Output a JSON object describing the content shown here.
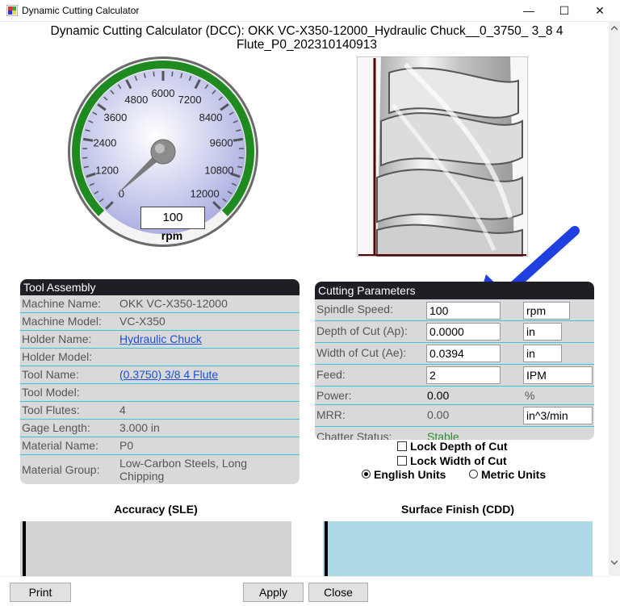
{
  "window": {
    "title": "Dynamic Cutting Calculator",
    "minimize": "—",
    "maximize": "☐",
    "close": "✕"
  },
  "header": {
    "title_line1": "Dynamic Cutting Calculator (DCC): OKK VC-X350-12000_Hydraulic Chuck__0_3750_ 3_8 4",
    "title_line2": "Flute_P0_202310140913"
  },
  "gauge": {
    "ticks": [
      "0",
      "1200",
      "2400",
      "3600",
      "4800",
      "6000",
      "7200",
      "8400",
      "9600",
      "10800",
      "12000"
    ],
    "value": "100",
    "value_number": 100,
    "max": 12000,
    "unit": "rpm"
  },
  "tool_assembly": {
    "header": "Tool Assembly",
    "rows": [
      {
        "label": "Machine Name:",
        "value": "OKK VC-X350-12000"
      },
      {
        "label": "Machine Model:",
        "value": "VC-X350"
      },
      {
        "label": "Holder Name:",
        "value": "Hydraulic Chuck"
      },
      {
        "label": "Holder Model:",
        "value": ""
      },
      {
        "label": "Tool Name:",
        "value": "(0.3750) 3/8 4 Flute"
      },
      {
        "label": "Tool Model:",
        "value": ""
      },
      {
        "label": "Tool Flutes:",
        "value": "4"
      },
      {
        "label": "Gage Length:",
        "value": "3.000 in"
      },
      {
        "label": "Material Name:",
        "value": "P0"
      },
      {
        "label": "Material Group:",
        "value": "Low-Carbon Steels, Long Chipping"
      }
    ]
  },
  "cutting_parameters": {
    "header": "Cutting Parameters",
    "spindle_speed": {
      "label": "Spindle Speed:",
      "value": "100",
      "unit": "rpm"
    },
    "depth_of_cut": {
      "label": "Depth of Cut (Ap):",
      "value": "0.0000",
      "unit": "in"
    },
    "width_of_cut": {
      "label": "Width of Cut (Ae):",
      "value": "0.0394",
      "unit": "in"
    },
    "feed": {
      "label": "Feed:",
      "value": "2",
      "unit": "IPM"
    },
    "power": {
      "label": "Power:",
      "value": "0.00",
      "unit": "%"
    },
    "mrr": {
      "label": "MRR:",
      "value": "0.00",
      "unit": "in^3/min"
    },
    "chatter": {
      "label": "Chatter Status:",
      "value": "Stable"
    }
  },
  "options": {
    "lock_depth": "Lock Depth of Cut",
    "lock_width": "Lock Width of Cut",
    "english_units": "English Units",
    "metric_units": "Metric Units",
    "selected_units": "English Units"
  },
  "accuracy": {
    "title": "Accuracy (SLE)"
  },
  "surface_finish": {
    "title": "Surface Finish (CDD)"
  },
  "buttons": {
    "print": "Print",
    "apply": "Apply",
    "close": "Close"
  },
  "colors": {
    "gauge_ring": "#1f8a1f",
    "gauge_face": "#b9bce6",
    "panel_bg": "#d9d9d9",
    "panel_header": "#1e1e24",
    "row_divider": "#39c3d6",
    "link": "#1a4fd6",
    "stable": "#2e8b2e",
    "arrow": "#1f3fe0",
    "surface_bar": "#add8e6",
    "accuracy_bar": "#d3d3d3"
  }
}
